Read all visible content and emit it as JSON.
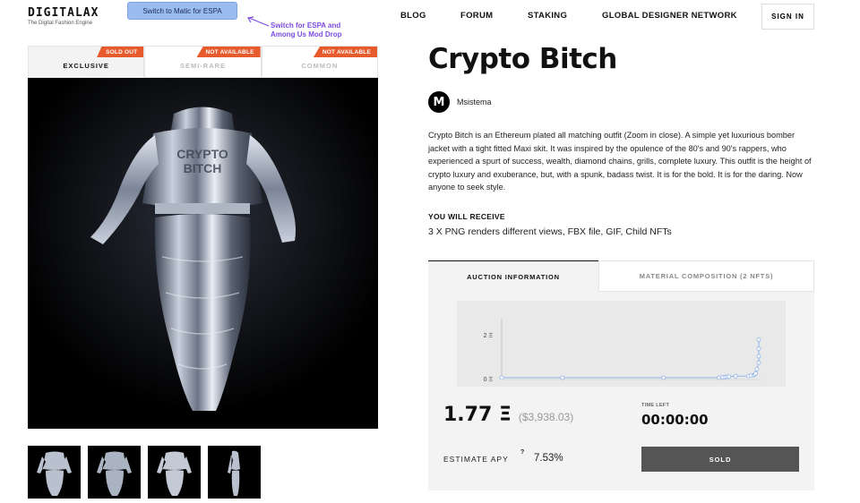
{
  "header": {
    "logo_title": "DIGITALAX",
    "logo_subtitle": "The Digital Fashion Engine",
    "switch_button": "Switch to Matic for ESPA",
    "annotation": "Switch for ESPA and Among Us Mod Drop",
    "nav": [
      "BLOG",
      "FORUM",
      "STAKING",
      "GLOBAL DESIGNER NETWORK"
    ],
    "signin": "SIGN IN"
  },
  "rarity_tabs": [
    {
      "label": "EXCLUSIVE",
      "badge": "SOLD OUT",
      "active": true
    },
    {
      "label": "SEMI-RARE",
      "badge": "NOT AVAILABLE",
      "active": false
    },
    {
      "label": "COMMON",
      "badge": "NOT AVAILABLE",
      "active": false
    }
  ],
  "product": {
    "title": "Crypto Bitch",
    "designer_initial": "M",
    "designer_name": "Msistema",
    "description": "Crypto Bitch is an Ethereum plated all matching outfit (Zoom in close). A simple yet luxurious bomber jacket with a tight fitted Maxi skit. It was inspired by the opulence of the 80's and 90's rappers, who experienced a spurt of success, wealth, diamond chains, grills, complete luxury. This outfit is the height of crypto luxury and exuberance, but, with a spunk, badass twist. It is for the bold. It is for the daring. Now anyone to seek style.",
    "jacket_text": [
      "CRYPTO",
      "BITCH"
    ],
    "receive_heading": "YOU WILL RECEIVE",
    "receive_value": "3 X PNG renders different views, FBX file, GIF, Child NFTs"
  },
  "panel_tabs": [
    "AUCTION INFORMATION",
    "MATERIAL COMPOSITION (2 NFTS)"
  ],
  "auction": {
    "price": "1.77 Ξ",
    "price_usd": "($3,938.03)",
    "time_left_label": "TIME LEFT",
    "time_left": "00:00:00",
    "apy_label": "ESTIMATE APY",
    "apy_help": "?",
    "apy_value": "7.53%",
    "action_button": "SOLD",
    "accent_color": "#e65a2c",
    "chart_line_color": "#8fb3e8"
  },
  "chart_data": {
    "type": "line",
    "ytick_labels": [
      "2 Ξ",
      "0 Ξ"
    ],
    "ylim": [
      0,
      2
    ],
    "xlim": [
      0,
      100
    ],
    "x": [
      0,
      23.6,
      63,
      84.5,
      86,
      87,
      87.7,
      88.4,
      91,
      96,
      97,
      98,
      98.5,
      98.8,
      99.3,
      100,
      100,
      100,
      100
    ],
    "y": [
      0,
      0,
      0,
      0,
      0.02,
      0.03,
      0.04,
      0.05,
      0.07,
      0.08,
      0.1,
      0.12,
      0.15,
      0.2,
      0.4,
      0.7,
      1.0,
      1.35,
      1.77
    ],
    "grid": false,
    "legend": "none"
  }
}
